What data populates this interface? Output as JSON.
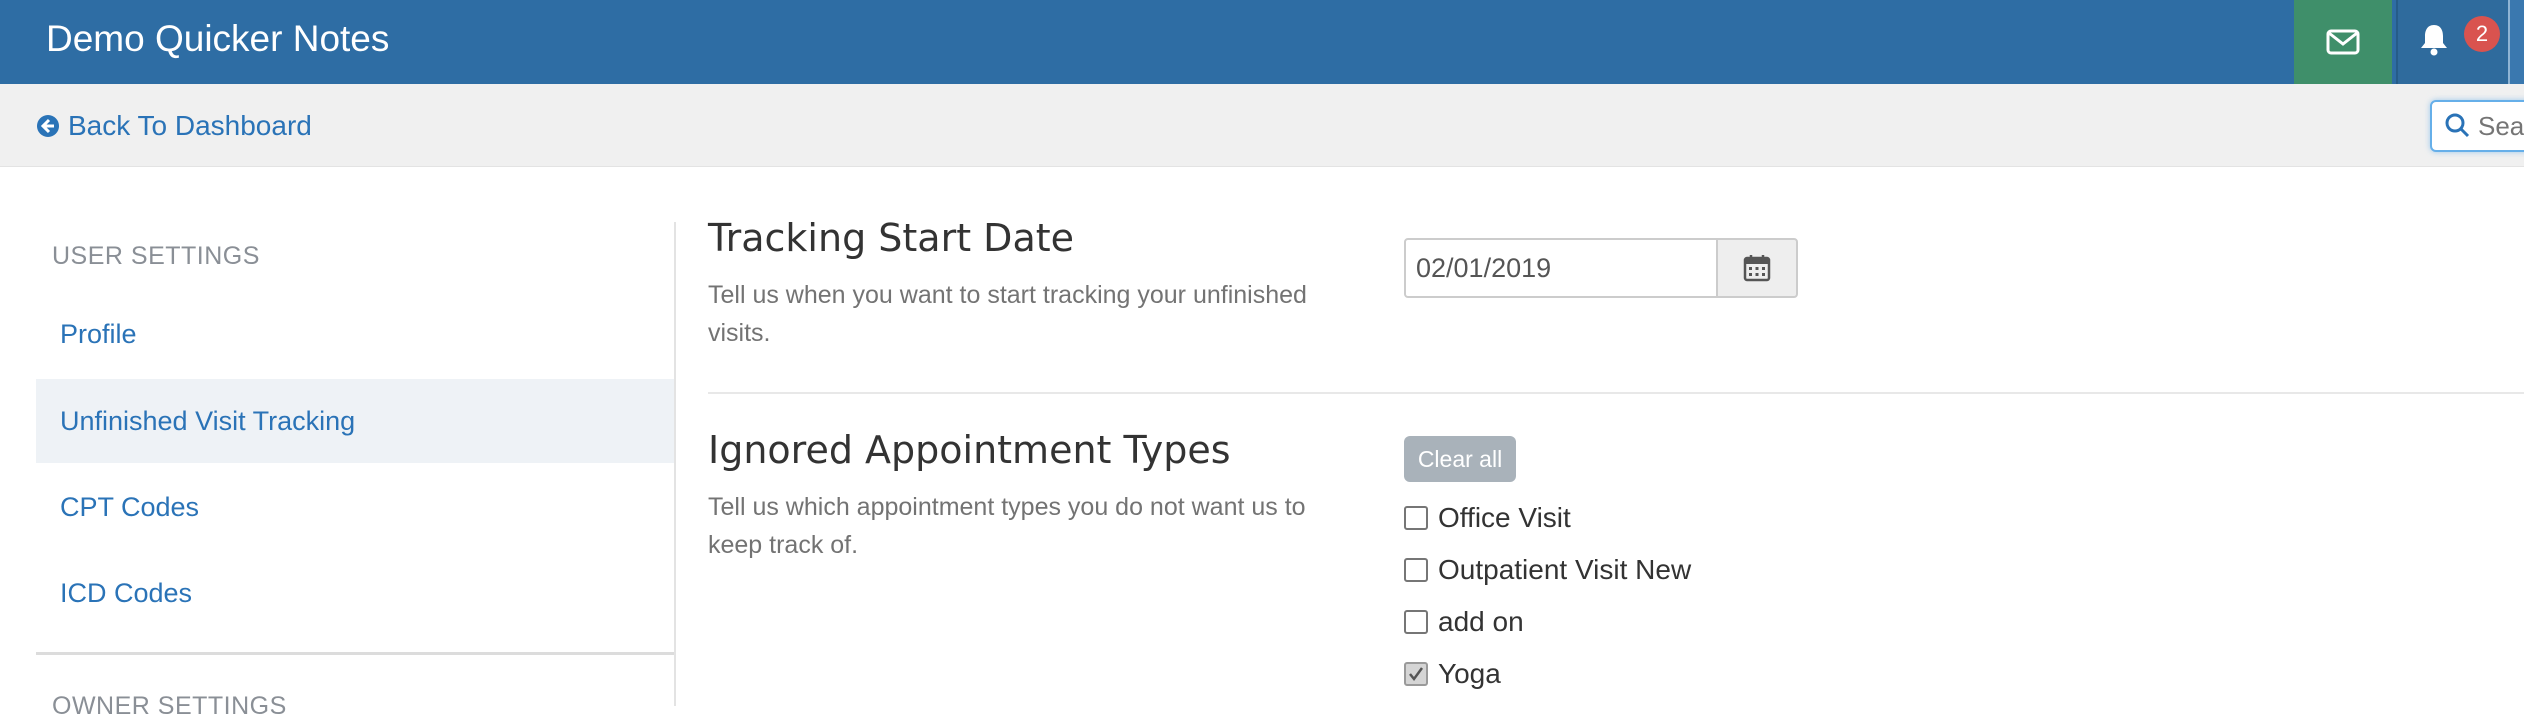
{
  "app": {
    "brand": "Demo Quicker Notes"
  },
  "navbar": {
    "notification_count": "2",
    "mail_icon": "envelope-icon",
    "bell_icon": "bell-icon"
  },
  "subheader": {
    "back_label": "Back To Dashboard",
    "search_placeholder": "Search"
  },
  "sidebar": {
    "heading": "USER SETTINGS",
    "items": [
      {
        "label": "Profile",
        "active": false
      },
      {
        "label": "Unfinished Visit Tracking",
        "active": true
      },
      {
        "label": "CPT Codes",
        "active": false
      },
      {
        "label": "ICD Codes",
        "active": false
      }
    ],
    "heading_2": "OWNER SETTINGS"
  },
  "tracking": {
    "title": "Tracking Start Date",
    "description": "Tell us when you want to start tracking your unfinished visits.",
    "date_value": "02/01/2019"
  },
  "ignored": {
    "title": "Ignored Appointment Types",
    "description": "Tell us which appointment types you do not want us to keep track of.",
    "clear_label": "Clear all",
    "options": [
      {
        "label": "Office Visit",
        "checked": false
      },
      {
        "label": "Outpatient Visit New",
        "checked": false
      },
      {
        "label": "add on",
        "checked": false
      },
      {
        "label": "Yoga",
        "checked": true
      }
    ]
  },
  "colors": {
    "navbar": "#2e6da4",
    "mail_button": "#3f8f6a",
    "badge": "#d9534f",
    "link": "#2a73b7"
  }
}
